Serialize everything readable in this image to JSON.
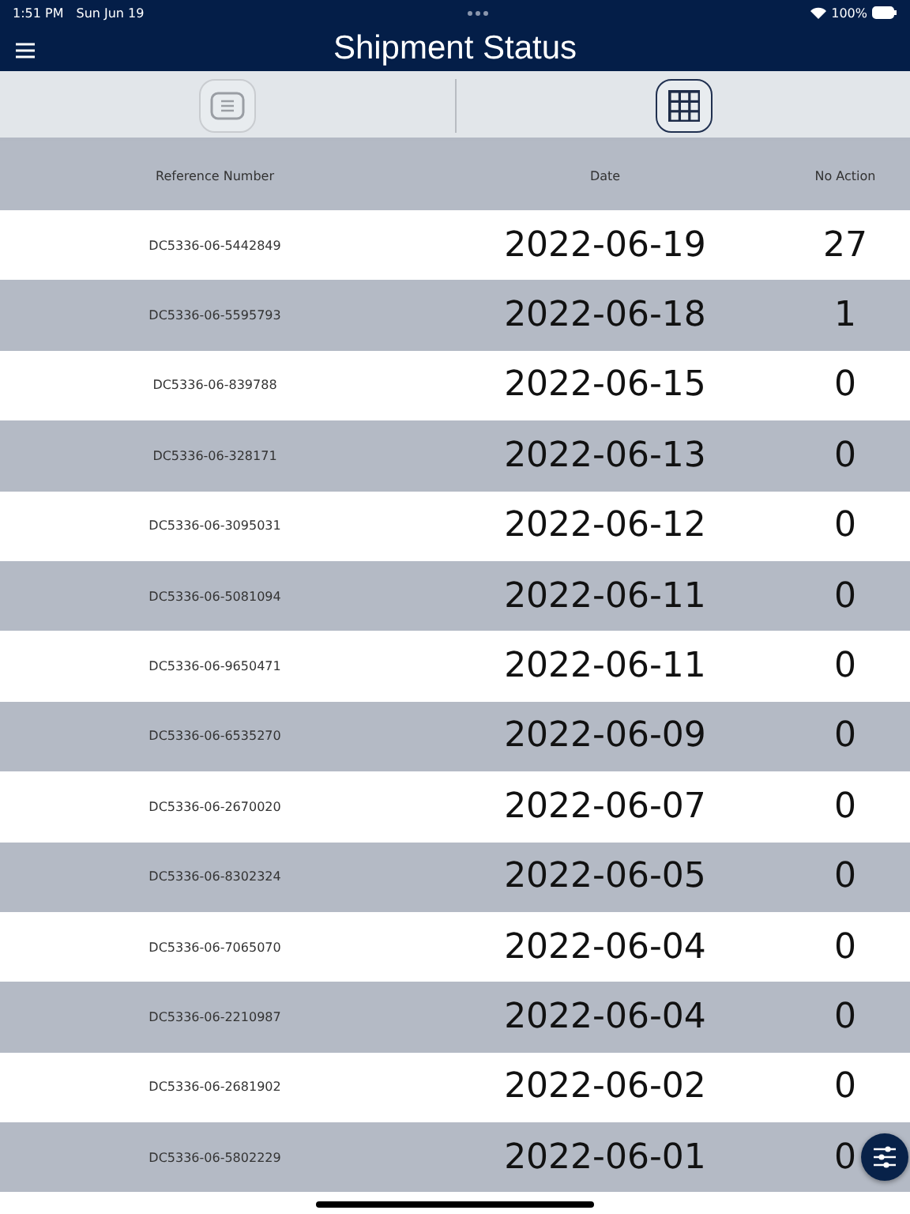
{
  "status_bar": {
    "time": "1:51 PM",
    "date": "Sun Jun 19",
    "battery": "100%"
  },
  "nav_bar": {
    "title": "Shipment Status"
  },
  "view_toggle": [
    {
      "kind": "list",
      "selected": false
    },
    {
      "kind": "grid",
      "selected": true
    }
  ],
  "table": {
    "columns": [
      "Reference Number",
      "Date",
      "No Action"
    ],
    "rows": [
      [
        "DC5336-06-5442849",
        "2022-06-19",
        "27"
      ],
      [
        "DC5336-06-5595793",
        "2022-06-18",
        "1"
      ],
      [
        "DC5336-06-839788",
        "2022-06-15",
        "0"
      ],
      [
        "DC5336-06-328171",
        "2022-06-13",
        "0"
      ],
      [
        "DC5336-06-3095031",
        "2022-06-12",
        "0"
      ],
      [
        "DC5336-06-5081094",
        "2022-06-11",
        "0"
      ],
      [
        "DC5336-06-9650471",
        "2022-06-11",
        "0"
      ],
      [
        "DC5336-06-6535270",
        "2022-06-09",
        "0"
      ],
      [
        "DC5336-06-2670020",
        "2022-06-07",
        "0"
      ],
      [
        "DC5336-06-8302324",
        "2022-06-05",
        "0"
      ],
      [
        "DC5336-06-7065070",
        "2022-06-04",
        "0"
      ],
      [
        "DC5336-06-2210987",
        "2022-06-04",
        "0"
      ],
      [
        "DC5336-06-2681902",
        "2022-06-02",
        "0"
      ],
      [
        "DC5336-06-5802229",
        "2022-06-01",
        "0"
      ]
    ]
  }
}
